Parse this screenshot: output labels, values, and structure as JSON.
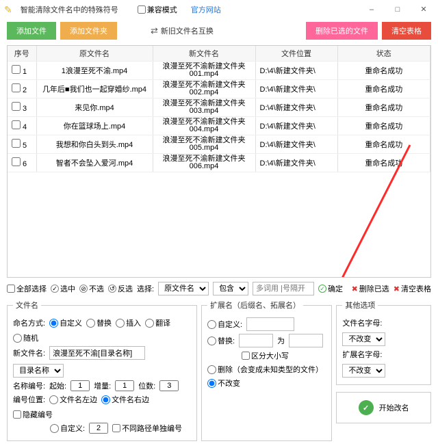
{
  "titlebar": {
    "title": "智能清除文件名中的特殊符号",
    "compat_label": "兼容模式",
    "official_site": "官方网站"
  },
  "toolbar": {
    "add_file": "添加文件",
    "add_folder": "添加文件夹",
    "swap": "新旧文件名互换",
    "delete_selected_files": "删除已选的文件",
    "clear_table": "清空表格"
  },
  "table": {
    "headers": {
      "seq": "序号",
      "orig": "原文件名",
      "new": "新文件名",
      "path": "文件位置",
      "status": "状态"
    },
    "rows": [
      {
        "seq": "1",
        "orig": "1浪漫至死不渝.mp4",
        "new": "浪漫至死不渝新建文件夹001.mp4",
        "path": "D:\\4\\新建文件夹\\",
        "status": "重命名成功"
      },
      {
        "seq": "2",
        "orig": "几年后■我们也一起穿婚纱.mp4",
        "new": "浪漫至死不渝新建文件夹002.mp4",
        "path": "D:\\4\\新建文件夹\\",
        "status": "重命名成功"
      },
      {
        "seq": "3",
        "orig": "来见你.mp4",
        "new": "浪漫至死不渝新建文件夹003.mp4",
        "path": "D:\\4\\新建文件夹\\",
        "status": "重命名成功"
      },
      {
        "seq": "4",
        "orig": "你在篮球场上.mp4",
        "new": "浪漫至死不渝新建文件夹004.mp4",
        "path": "D:\\4\\新建文件夹\\",
        "status": "重命名成功"
      },
      {
        "seq": "5",
        "orig": "我想和你白头到头.mp4",
        "new": "浪漫至死不渝新建文件夹005.mp4",
        "path": "D:\\4\\新建文件夹\\",
        "status": "重命名成功"
      },
      {
        "seq": "6",
        "orig": "智者不会坠入爱河.mp4",
        "new": "浪漫至死不渝新建文件夹006.mp4",
        "path": "D:\\4\\新建文件夹\\",
        "status": "重命名成功"
      }
    ]
  },
  "selbar": {
    "select_all": "全部选择",
    "select": "选中",
    "deselect": "不选",
    "invert": "反选",
    "choose_label": "选择:",
    "field_select": "原文件名",
    "match_select": "包含",
    "multi_placeholder": "多词用 |号隔开",
    "confirm": "确定",
    "delete_selected": "删除已选",
    "clear_table": "清空表格"
  },
  "filename_panel": {
    "legend": "文件名",
    "naming_label": "命名方式:",
    "opt_custom": "自定义",
    "opt_replace": "替换",
    "opt_insert": "插入",
    "opt_translate": "翻译",
    "opt_random": "随机",
    "new_name_label": "新文件名:",
    "new_name_value": "浪漫至死不渝[目录名称]",
    "dir_select": "目录名称",
    "number_label": "名称编号:",
    "start_label": "起始:",
    "start_val": "1",
    "step_label": "增量:",
    "step_val": "1",
    "digits_label": "位数:",
    "digits_val": "3",
    "pos_label": "编号位置:",
    "pos_left": "文件名左边",
    "pos_right": "文件名右边",
    "hide_number": "隐藏编号",
    "pos_custom": "自定义:",
    "pos_custom_val": "2",
    "no_same_path": "不同路径单独编号"
  },
  "ext_panel": {
    "legend": "扩展名（后缀名、拓展名）",
    "opt_custom": "自定义:",
    "opt_replace": "替换:",
    "to": "为",
    "case_sensitive": "区分大小写",
    "opt_delete": "删除（会变成未知类型的文件）",
    "opt_unchanged": "不改变"
  },
  "other_panel": {
    "legend": "其他选项",
    "filename_font": "文件名字母:",
    "ext_font": "扩展名字母:",
    "unchanged": "不改变",
    "start_rename": "开始改名"
  }
}
